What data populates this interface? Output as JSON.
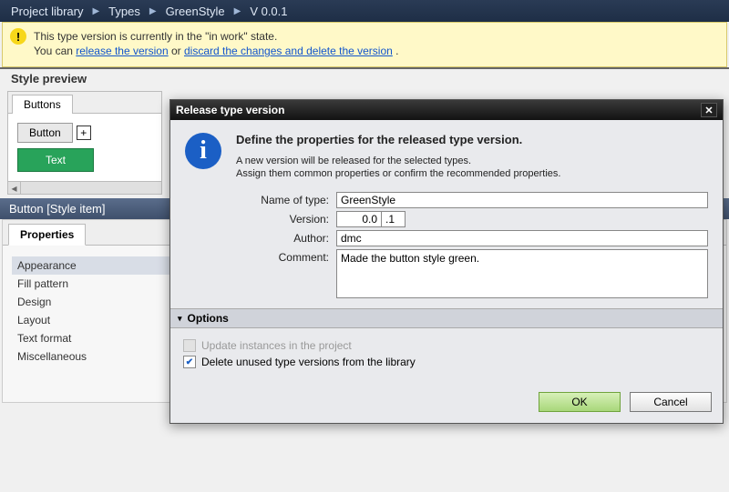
{
  "breadcrumb": [
    "Project library",
    "Types",
    "GreenStyle",
    "V 0.0.1"
  ],
  "warn": {
    "line1": "This type version is currently in the \"in work\" state.",
    "line2_a": "You can ",
    "link1": "release the version",
    "or": " or ",
    "link2": "discard the changes and delete the version",
    "dot": " ."
  },
  "preview": {
    "title": "Style preview",
    "tab": "Buttons",
    "btn_grey": "Button",
    "plus": "+",
    "btn_green": "Text"
  },
  "panel_title": "Button [Style item]",
  "props": {
    "tab": "Properties",
    "items": [
      "Appearance",
      "Fill pattern",
      "Design",
      "Layout",
      "Text format",
      "Miscellaneous"
    ]
  },
  "dialog": {
    "title": "Release type version",
    "heading": "Define the properties for the released type version.",
    "p1": "A new version will be released for the selected types.",
    "p2": "Assign them common properties or confirm the recommended properties.",
    "lbl_name": "Name of type:",
    "name": "GreenStyle",
    "lbl_version": "Version:",
    "ver_major": "0.0",
    "ver_minor": ".1",
    "lbl_author": "Author:",
    "author": "dmc",
    "lbl_comment": "Comment:",
    "comment": "Made the button style green.",
    "options": "Options",
    "chk1": "Update instances in the project",
    "chk2": "Delete unused type versions from the library",
    "ok": "OK",
    "cancel": "Cancel"
  }
}
